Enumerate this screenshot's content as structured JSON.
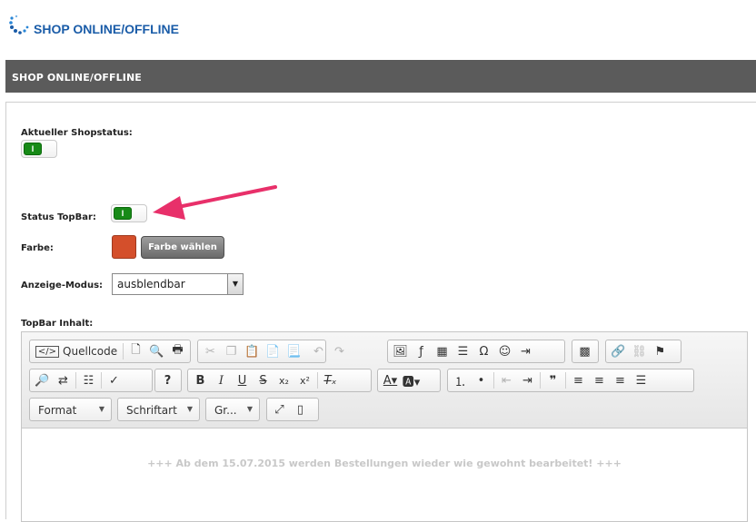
{
  "header": {
    "title": "SHOP ONLINE/OFFLINE"
  },
  "section": {
    "title": "SHOP ONLINE/OFFLINE"
  },
  "form": {
    "shop_status_label": "Aktueller Shopstatus:",
    "shop_status_toggle": "I",
    "topbar_status_label": "Status TopBar:",
    "topbar_status_toggle": "I",
    "color_label": "Farbe:",
    "color_value": "#d44f2b",
    "color_button": "Farbe wählen",
    "display_mode_label": "Anzeige-Modus:",
    "display_mode_value": "ausblendbar",
    "content_label": "TopBar Inhalt:"
  },
  "editor": {
    "source_label": "Quellcode",
    "format_label": "Format",
    "font_label": "Schriftart",
    "size_label": "Gr...",
    "content_text": "+++ Ab dem 15.07.2015 werden Bestellungen wieder wie gewohnt bearbeitet! +++"
  },
  "colors": {
    "accent": "#1a5ca8",
    "bar": "#5b5b5b",
    "toggle_on": "#178a17",
    "arrow": "#e8306a"
  }
}
